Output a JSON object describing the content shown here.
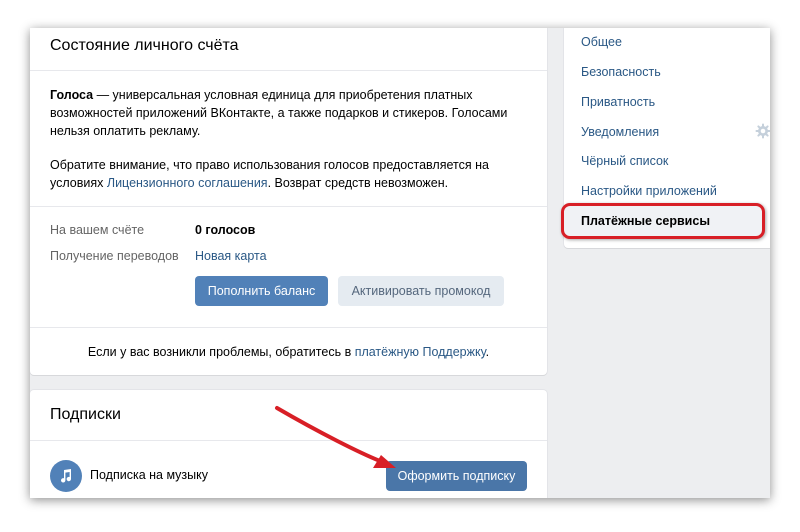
{
  "balance_card": {
    "title": "Состояние личного счёта",
    "intro_term": "Голоса",
    "intro_rest": " — универсальная условная единица для приобретения платных возможностей приложений ВКонтакте, а также подарков и стикеров. Голосами нельзя оплатить рекламу.",
    "notice_before": "Обратите внимание, что право использования голосов предоставляется на условиях ",
    "notice_link": "Лицензионного соглашения",
    "notice_after": ". Возврат средств невозможен.",
    "account_label": "На вашем счёте",
    "account_value": "0 голосов",
    "transfer_label": "Получение переводов",
    "transfer_value": "Новая карта",
    "topup_button": "Пополнить баланс",
    "promo_button": "Активировать промокод",
    "help_before": "Если у вас возникли проблемы, обратитесь в ",
    "help_link": "платёжную Поддержку",
    "help_after": "."
  },
  "subscriptions": {
    "title": "Подписки",
    "music_label": "Подписка на музыку",
    "subscribe_button": "Оформить подписку",
    "icon": "music-note-icon"
  },
  "settings_nav": {
    "items": [
      {
        "label": "Общее"
      },
      {
        "label": "Безопасность"
      },
      {
        "label": "Приватность"
      },
      {
        "label": "Уведомления"
      },
      {
        "label": "Чёрный список"
      },
      {
        "label": "Настройки приложений"
      },
      {
        "label": "Платёжные сервисы",
        "active": true
      }
    ]
  },
  "colors": {
    "accent": "#5181b8",
    "link": "#2a5885",
    "annotation_red": "#d81f26",
    "background": "#edeef0"
  }
}
